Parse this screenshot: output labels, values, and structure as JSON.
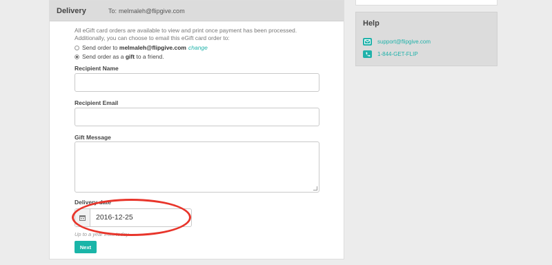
{
  "delivery": {
    "title": "Delivery",
    "to_label": "To:",
    "to_email": "melmaleh@flipgive.com",
    "intro": "All eGift card orders are available to view and print once payment has been processed. Additionally, you can choose to email this eGift card order to:",
    "option_self_prefix": "Send order to",
    "option_self_email": "melmaleh@flipgive.com",
    "option_self_link": "change",
    "option_gift_prefix": "Send order as a",
    "option_gift_bold": "gift",
    "option_gift_suffix": "to a friend.",
    "recipient_name_label": "Recipient Name",
    "recipient_name_value": "",
    "recipient_email_label": "Recipient Email",
    "recipient_email_value": "",
    "gift_message_label": "Gift Message",
    "gift_message_value": "",
    "delivery_date_label": "Delivery date",
    "delivery_date_value": "2016-12-25",
    "delivery_date_help": "Up to a year from today",
    "next_button": "Next"
  },
  "help": {
    "title": "Help",
    "email": "support@flipgive.com",
    "phone": "1-844-GET-FLIP"
  },
  "colors": {
    "accent": "#1ab5a8",
    "annotation": "#e8352b"
  }
}
